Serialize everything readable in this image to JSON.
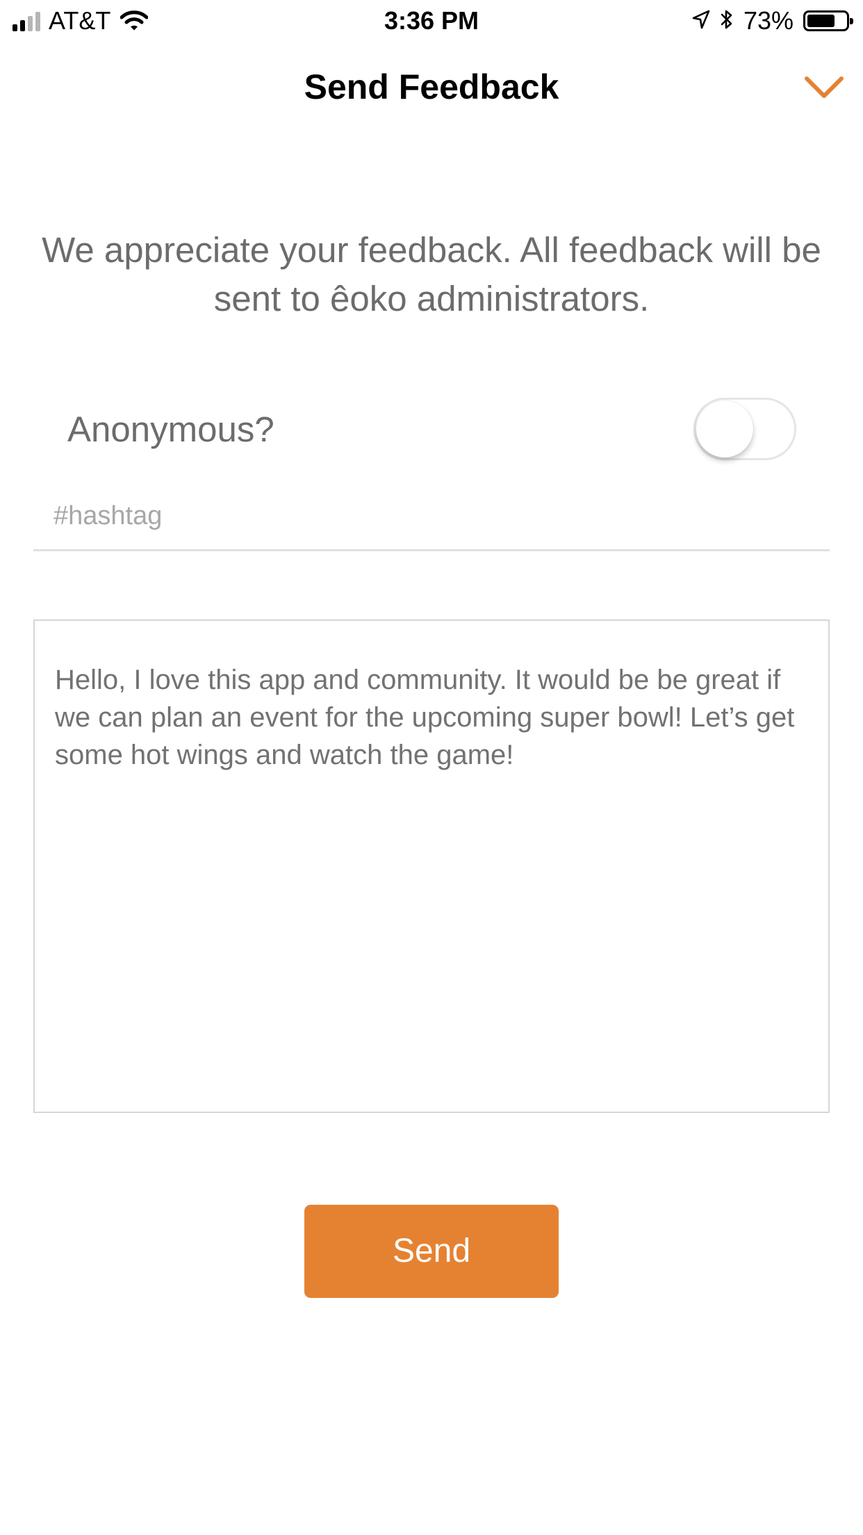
{
  "status_bar": {
    "carrier": "AT&T",
    "time": "3:36 PM",
    "battery_percent": "73%",
    "battery_level": 0.73,
    "signal_bars_filled": 2,
    "signal_bars_total": 4,
    "icons": [
      "signal-icon",
      "wifi-icon",
      "location-arrow-icon",
      "bluetooth-icon",
      "battery-icon"
    ]
  },
  "header": {
    "title": "Send Feedback",
    "close_icon": "chevron-down-icon"
  },
  "intro": {
    "text": "We appreciate your feedback. All feedback will be sent to êoko administrators."
  },
  "anonymous": {
    "label": "Anonymous?",
    "enabled": false
  },
  "hashtag": {
    "value": "",
    "placeholder": "#hashtag"
  },
  "message": {
    "value": "Hello, I love this app and community. It would be be great if we can plan an event for the upcoming super bowl! Let’s get some hot wings and watch the game!"
  },
  "send_button": {
    "label": "Send"
  },
  "colors": {
    "accent": "#E58232",
    "text_secondary": "#6C6C6C",
    "placeholder": "#A7A7A7"
  }
}
